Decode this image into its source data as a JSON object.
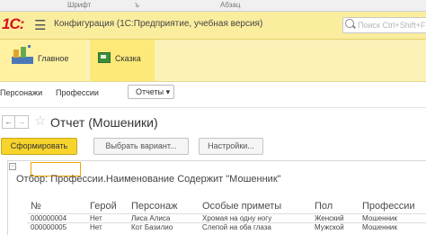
{
  "top_strip": {
    "left_text": "Шрифт",
    "mid_text": "ъ",
    "right_text": "Абзац"
  },
  "app": {
    "logo": "1С:",
    "title": "Конфигурация  (1С:Предприятие, учебная версия)",
    "search_placeholder": "Поиск Ctrl+Shift+F",
    "accent_color": "#fbed9e"
  },
  "sections": [
    {
      "label": "Главное",
      "icon": "home-sections-icon"
    },
    {
      "label": "Сказка",
      "icon": "book-icon"
    }
  ],
  "nav": {
    "items": [
      "Персонажи",
      "Профессии"
    ],
    "reports_button": "Отчеты ▾"
  },
  "form": {
    "title": "Отчет (Мошеники)",
    "buttons": {
      "generate": "Сформировать",
      "choose_variant": "Выбрать вариант...",
      "settings": "Настройки..."
    }
  },
  "report": {
    "filter": "Отбор:    Профессии.Наименование Содержит \"Мошенник\"",
    "columns": [
      "№",
      "Герой",
      "Персонаж",
      "Особые приметы",
      "Пол",
      "Профессии"
    ],
    "rows": [
      [
        "000000004",
        "Нет",
        "Лиса Алиса",
        "Хромая на одну ногу",
        "Женский",
        "Мошенник"
      ],
      [
        "000000005",
        "Нет",
        "Кот Базилио",
        "Слепой на оба глаза",
        "Мужской",
        "Мошенник"
      ]
    ]
  }
}
